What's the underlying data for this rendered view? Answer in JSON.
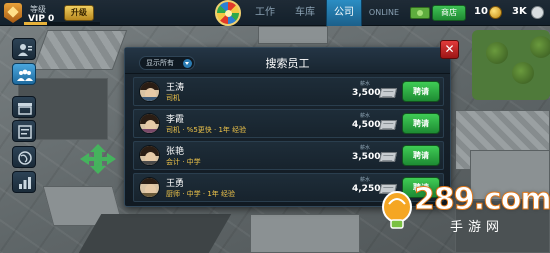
{
  "hud": {
    "level_label": "等级",
    "vip_label": "VIP 0",
    "upgrade_label": "升级",
    "level_progress": 0.3,
    "tabs": [
      {
        "label": "工作",
        "active": false
      },
      {
        "label": "车库",
        "active": false
      },
      {
        "label": "公司",
        "active": true
      },
      {
        "label": "ONLINE",
        "active": false
      }
    ],
    "shop_label": "商店",
    "coins": "10",
    "money": "3K"
  },
  "sidebar": {
    "icons": [
      "profile-icon",
      "staff-icon",
      "garage-icon",
      "tasks-icon",
      "world-icon",
      "stats-icon"
    ],
    "active": "staff-icon"
  },
  "dialog": {
    "title": "搜索员工",
    "filter": "显示所有",
    "close_label": "✕",
    "salary_caption": "薪水",
    "hire_label": "聘请",
    "employees": [
      {
        "name": "王涛",
        "role": "司机",
        "salary": "3,500"
      },
      {
        "name": "李霞",
        "role": "司机 · %5更快 · 1年 经验",
        "salary": "4,500"
      },
      {
        "name": "张艳",
        "role": "会计 · 中学",
        "salary": "3,500"
      },
      {
        "name": "王勇",
        "role": "厨师 · 中学 · 1年 经验",
        "salary": "4,250"
      }
    ]
  },
  "watermark": {
    "main": "289.com",
    "sub": "手游网"
  },
  "colors": {
    "accent": "#2b8ec4",
    "hire_green": "#3fcc55",
    "role_yellow": "#f0c54a",
    "close_red": "#e13a3a"
  }
}
